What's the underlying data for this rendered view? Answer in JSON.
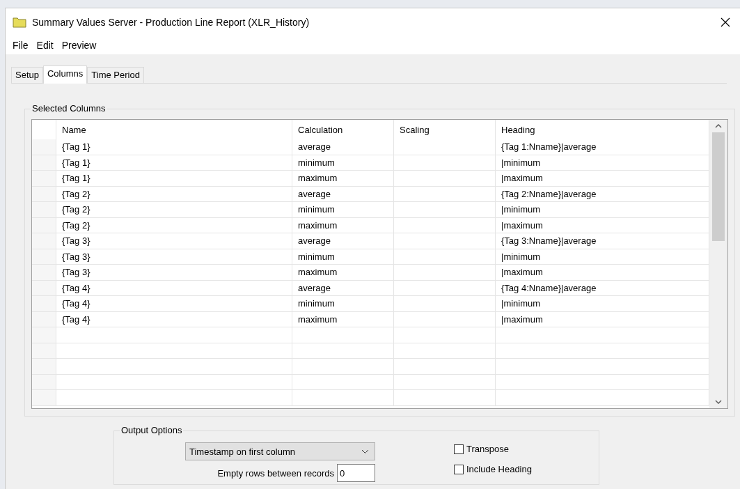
{
  "window": {
    "title": "Summary Values Server - Production Line Report (XLR_History)"
  },
  "menu": [
    "File",
    "Edit",
    "Preview"
  ],
  "tabs": [
    {
      "label": "Setup",
      "selected": false
    },
    {
      "label": "Columns",
      "selected": true
    },
    {
      "label": "Time Period",
      "selected": false
    }
  ],
  "selected_columns": {
    "title": "Selected Columns",
    "columns": [
      "Name",
      "Calculation",
      "Scaling",
      "Heading"
    ],
    "rows": [
      [
        "{Tag 1}",
        "average",
        "",
        "{Tag 1:Nname}|average"
      ],
      [
        "{Tag 1}",
        "minimum",
        "",
        "|minimum"
      ],
      [
        "{Tag 1}",
        "maximum",
        "",
        "|maximum"
      ],
      [
        "{Tag 2}",
        "average",
        "",
        "{Tag 2:Nname}|average"
      ],
      [
        "{Tag 2}",
        "minimum",
        "",
        "|minimum"
      ],
      [
        "{Tag 2}",
        "maximum",
        "",
        "|maximum"
      ],
      [
        "{Tag 3}",
        "average",
        "",
        "{Tag 3:Nname}|average"
      ],
      [
        "{Tag 3}",
        "minimum",
        "",
        "|minimum"
      ],
      [
        "{Tag 3}",
        "maximum",
        "",
        "|maximum"
      ],
      [
        "{Tag 4}",
        "average",
        "",
        "{Tag 4:Nname}|average"
      ],
      [
        "{Tag 4}",
        "minimum",
        "",
        "|minimum"
      ],
      [
        "{Tag 4}",
        "maximum",
        "",
        "|maximum"
      ]
    ]
  },
  "output_options": {
    "title": "Output Options",
    "timestamp_mode": "Timestamp on first column",
    "empty_rows_label": "Empty rows between records",
    "empty_rows_value": "0",
    "checkboxes": [
      {
        "label": "Transpose",
        "checked": false
      },
      {
        "label": "Include Heading",
        "checked": false
      }
    ]
  }
}
